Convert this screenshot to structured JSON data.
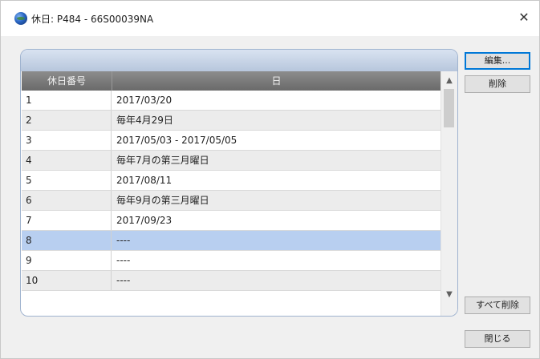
{
  "window": {
    "title": "休日: P484 - 66S00039NA",
    "close_glyph": "✕"
  },
  "table": {
    "columns": [
      "休日番号",
      "日"
    ],
    "rows": [
      {
        "no": "1",
        "date": "2017/03/20"
      },
      {
        "no": "2",
        "date": "毎年4月29日"
      },
      {
        "no": "3",
        "date": "2017/05/03 - 2017/05/05"
      },
      {
        "no": "4",
        "date": "毎年7月の第三月曜日"
      },
      {
        "no": "5",
        "date": "2017/08/11"
      },
      {
        "no": "6",
        "date": "毎年9月の第三月曜日"
      },
      {
        "no": "7",
        "date": "2017/09/23"
      },
      {
        "no": "8",
        "date": "----"
      },
      {
        "no": "9",
        "date": "----"
      },
      {
        "no": "10",
        "date": "----"
      }
    ],
    "selected_row": 8
  },
  "scrollbar": {
    "up_glyph": "▲",
    "down_glyph": "▼"
  },
  "buttons": {
    "edit": "編集...",
    "delete": "削除",
    "delete_all": "すべて削除",
    "close": "閉じる"
  },
  "colors": {
    "selection": "#b8cff0",
    "header": "#7a7a7a",
    "frame_border": "#9fb3cf"
  }
}
